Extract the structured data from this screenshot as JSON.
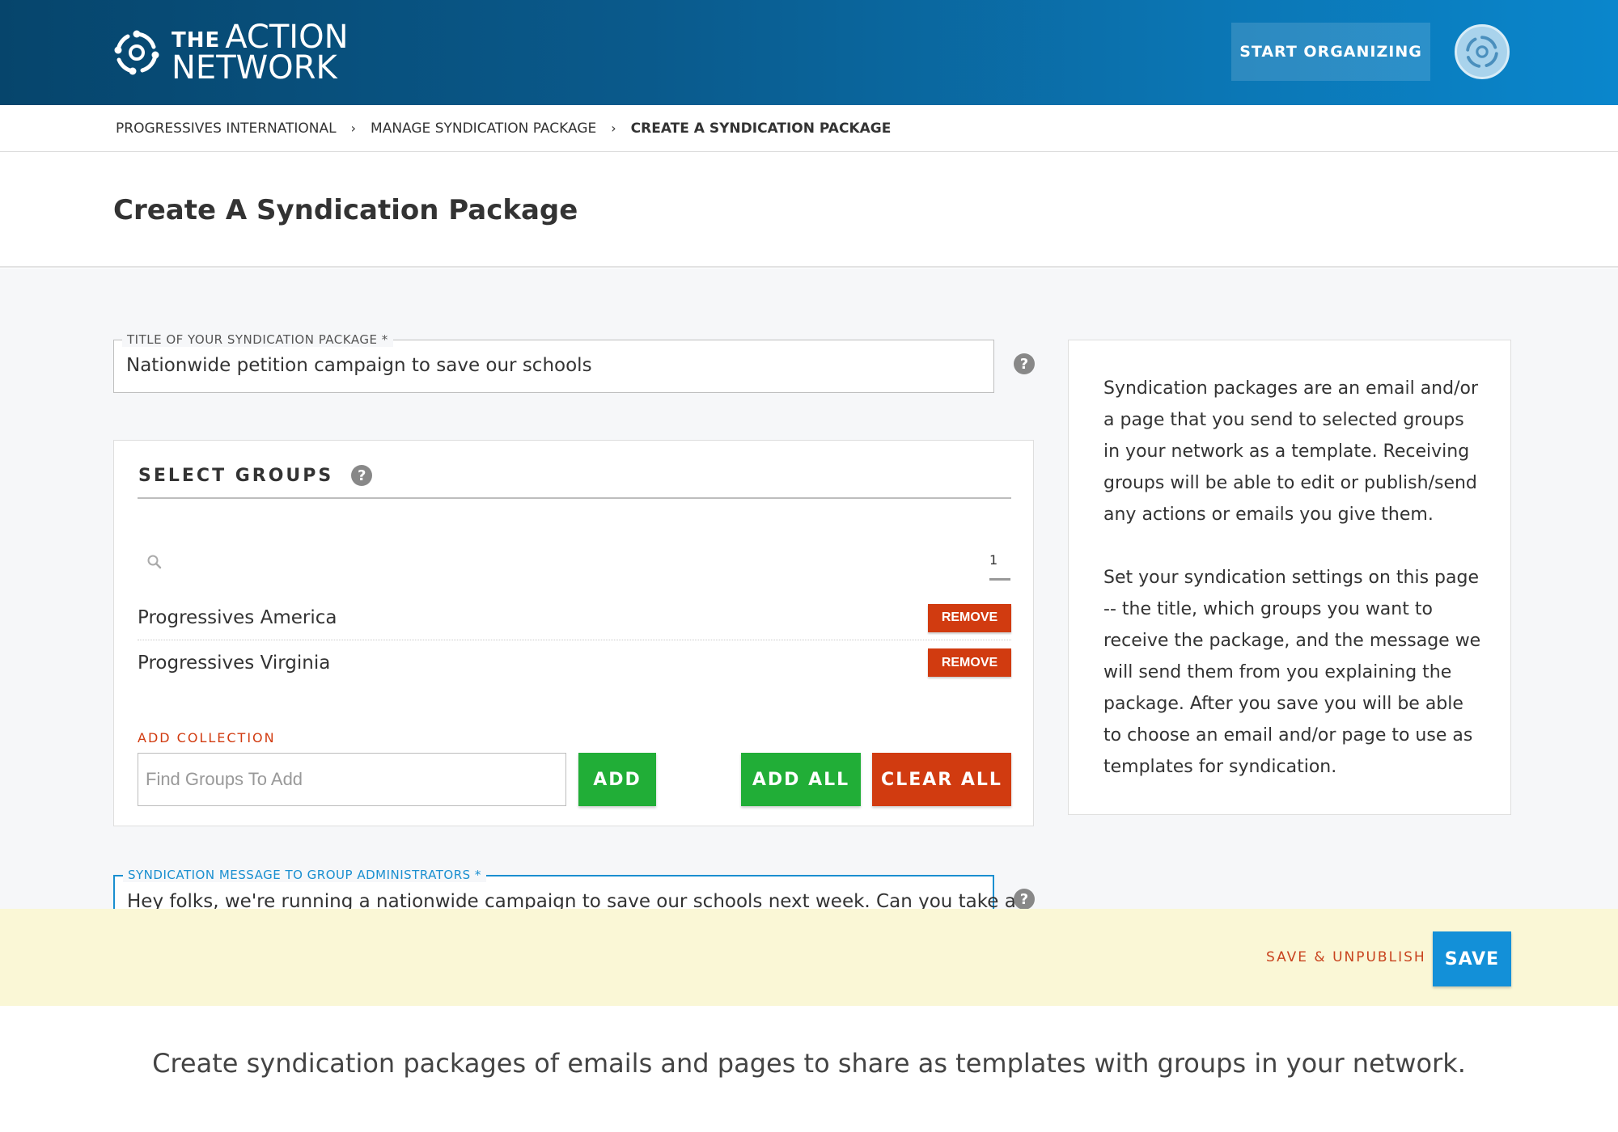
{
  "brand": {
    "logo_the": "THE",
    "logo_action": "ACTION",
    "logo_network": "NETWORK",
    "header_bg_start": "#06456c",
    "header_bg_end": "#0a86cc"
  },
  "header": {
    "start_organizing_label": "START ORGANIZING"
  },
  "breadcrumb": {
    "items": [
      "PROGRESSIVES INTERNATIONAL",
      "MANAGE SYNDICATION PACKAGE",
      "CREATE A SYNDICATION PACKAGE"
    ],
    "separator": "›"
  },
  "page": {
    "title": "Create A Syndication Package"
  },
  "title_field": {
    "label": "TITLE OF YOUR SYNDICATION PACKAGE *",
    "value": "Nationwide petition campaign to save our schools"
  },
  "select_groups": {
    "heading": "SELECT GROUPS",
    "page_number": "1",
    "groups": [
      {
        "name": "Progressives America",
        "action": "REMOVE"
      },
      {
        "name": "Progressives Virginia",
        "action": "REMOVE"
      }
    ],
    "add_collection_label": "ADD COLLECTION",
    "find_placeholder": "Find Groups To Add",
    "add_label": "ADD",
    "add_all_label": "ADD ALL",
    "clear_all_label": "CLEAR ALL"
  },
  "message_field": {
    "label": "SYNDICATION MESSAGE TO GROUP ADMINISTRATORS *",
    "value": "Hey folks, we're running a nationwide campaign to save our schools next week. Can you take a"
  },
  "info": {
    "paragraph1": "Syndication packages are an email and/or a page that you send to selected groups in your network as a template. Receiving groups will be able to edit or publish/send any actions or emails you give them.",
    "paragraph2": "Set your syndication settings on this page -- the title, which groups you want to receive the package, and the message we will send them from you explaining the package. After you save you will be able to choose an email and/or page to use as templates for syndication."
  },
  "save_bar": {
    "save_unpublish_label": "SAVE & UNPUBLISH",
    "save_label": "SAVE"
  },
  "caption": "Create syndication packages of emails and pages to share as templates with groups in your network.",
  "icons": {
    "help": "question-circle-icon",
    "search": "search-icon",
    "logo": "action-network-logo-icon"
  },
  "colors": {
    "green": "#21ae37",
    "red": "#d13b10",
    "blue": "#1390d8",
    "save_bar_bg": "#faf7d6"
  }
}
